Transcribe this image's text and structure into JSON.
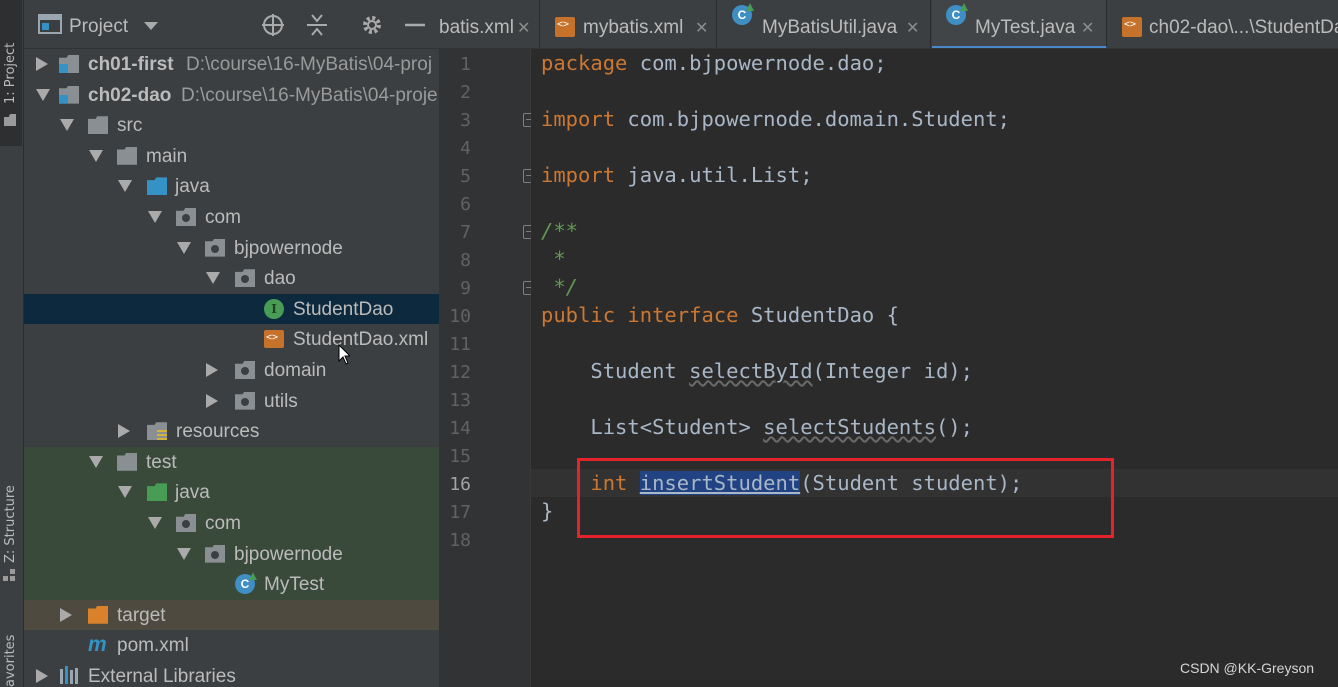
{
  "tool_strip": {
    "project_tab": "1: Project",
    "structure_tab": "Z: Structure",
    "favorites_tab": "avorites"
  },
  "project_panel": {
    "title": "Project",
    "icons": [
      "target-icon",
      "collapse-icon",
      "gear-icon",
      "minimize-icon"
    ],
    "tree": [
      {
        "label": "ch01-first",
        "path": "D:\\course\\16-MyBatis\\04-proj"
      },
      {
        "label": "ch02-dao",
        "path": "D:\\course\\16-MyBatis\\04-proje"
      },
      {
        "label": "src"
      },
      {
        "label": "main"
      },
      {
        "label": "java"
      },
      {
        "label": "com"
      },
      {
        "label": "bjpowernode"
      },
      {
        "label": "dao"
      },
      {
        "label": "StudentDao"
      },
      {
        "label": "StudentDao.xml"
      },
      {
        "label": "domain"
      },
      {
        "label": "utils"
      },
      {
        "label": "resources"
      },
      {
        "label": "test"
      },
      {
        "label": "java"
      },
      {
        "label": "com"
      },
      {
        "label": "bjpowernode"
      },
      {
        "label": "MyTest"
      },
      {
        "label": "target"
      },
      {
        "label": "pom.xml"
      },
      {
        "label": "External Libraries"
      }
    ]
  },
  "tabs": [
    {
      "label": "batis.xml"
    },
    {
      "label": "mybatis.xml"
    },
    {
      "label": "MyBatisUtil.java"
    },
    {
      "label": "MyTest.java"
    },
    {
      "label": "ch02-dao\\...\\StudentDa"
    }
  ],
  "editor": {
    "line_numbers": [
      "1",
      "2",
      "3",
      "4",
      "5",
      "6",
      "7",
      "8",
      "9",
      "10",
      "11",
      "12",
      "13",
      "14",
      "15",
      "16",
      "17",
      "18"
    ],
    "current_line": "16",
    "code": {
      "l1_kw": "package",
      "l1_rest": " com.bjpowernode.dao;",
      "l3_kw": "import",
      "l3_rest": " com.bjpowernode.domain.Student;",
      "l5_kw": "import",
      "l5_rest": " java.util.List;",
      "l7": "/**",
      "l8": " *",
      "l9": " */",
      "l10_kw1": "public",
      "l10_kw2": "interface",
      "l10_rest": " StudentDao {",
      "l12_type": "    Student ",
      "l12_method": "selectById",
      "l12_rest": "(Integer id);",
      "l14_type": "    List<Student> ",
      "l14_method": "selectStudents",
      "l14_rest": "();",
      "l16_kw": "    int ",
      "l16_method": "insertStudent",
      "l16_rest": "(Student student);",
      "l17": "}"
    }
  },
  "watermark": "CSDN @KK-Greyson",
  "colors": {
    "keyword": "#cc7832",
    "comment": "#629755",
    "highlight_box": "#e5232a",
    "selection": "#214283"
  }
}
